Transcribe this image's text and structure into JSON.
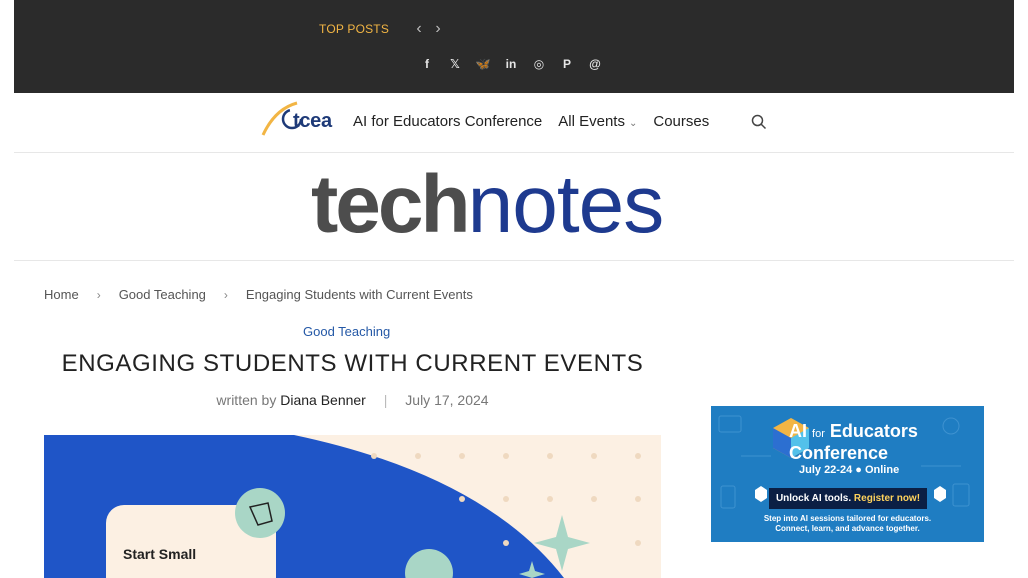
{
  "topbar": {
    "label": "TOP POSTS",
    "prev_icon": "chevron-left-icon",
    "next_icon": "chevron-right-icon",
    "social": [
      {
        "name": "facebook-icon",
        "glyph": "f"
      },
      {
        "name": "x-icon",
        "glyph": "𝕏"
      },
      {
        "name": "bluesky-icon",
        "glyph": "🦋"
      },
      {
        "name": "linkedin-icon",
        "glyph": "in"
      },
      {
        "name": "instagram-icon",
        "glyph": "◎"
      },
      {
        "name": "pinterest-icon",
        "glyph": "P"
      },
      {
        "name": "threads-icon",
        "glyph": "@"
      }
    ]
  },
  "nav": {
    "logo_text": "tcea",
    "items": [
      {
        "label": "AI for Educators Conference"
      },
      {
        "label": "All Events"
      },
      {
        "label": "Courses"
      }
    ]
  },
  "brand": {
    "part1": "tech",
    "part2": "notes"
  },
  "breadcrumb": {
    "items": [
      "Home",
      "Good Teaching",
      "Engaging Students with Current Events"
    ]
  },
  "article": {
    "category": "Good Teaching",
    "title": "ENGAGING STUDENTS WITH CURRENT EVENTS",
    "byline_prefix": "written by",
    "author": "Diana Benner",
    "date": "July 17, 2024",
    "hero_card_text": "Start Small"
  },
  "ad": {
    "title_line1_a": "AI",
    "title_line1_b": "for",
    "title_line1_c": "Educators",
    "title_line2": "Conference",
    "date": "July 22-24 ● Online",
    "button_a": "Unlock AI tools.",
    "button_b": "Register now!",
    "sub_line1": "Step into AI sessions tailored for educators.",
    "sub_line2": "Connect, learn, and advance together."
  },
  "colors": {
    "topbar_bg": "#2b2b2b",
    "accent_gold": "#f2b544",
    "brand_blue": "#1e3a8f",
    "link_blue": "#2458a6",
    "ad_blue": "#1f7dc2"
  }
}
